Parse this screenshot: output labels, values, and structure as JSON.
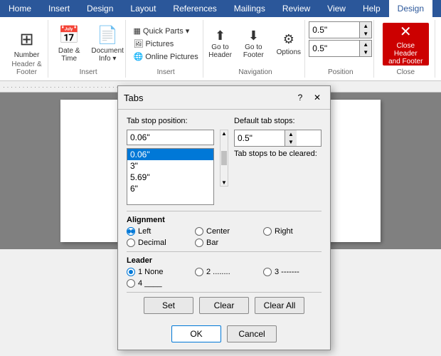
{
  "ribbon": {
    "tabs": [
      "Home",
      "Insert",
      "Design",
      "Layout",
      "References",
      "Mailings",
      "Review",
      "View",
      "Help",
      "Design"
    ],
    "active_tab": "Design",
    "groups": {
      "number": {
        "label": "Header & Footer",
        "btn": "Number"
      },
      "datetime": {
        "label": "Insert",
        "btn1": "Date &\nTime",
        "btn2": "Document\nInfo"
      },
      "insert": {
        "label": "Insert",
        "items": [
          "Quick Parts",
          "Pictures",
          "Online Pictures"
        ]
      },
      "navigation": {
        "label": "Navigation",
        "go_to_header": "Go to\nHeader",
        "go_to_footer": "Go to\nFooter",
        "options": "Options"
      },
      "position": {
        "label": "Position",
        "val1": "0.5\"",
        "val2": "0.5\""
      },
      "close": {
        "label": "Close",
        "btn": "Close Header\nand Footer"
      }
    }
  },
  "dialog": {
    "title": "Tabs",
    "tab_stop_position_label": "Tab stop position:",
    "tab_stop_position_value": "0.06\"",
    "default_tab_stops_label": "Default tab stops:",
    "default_tab_stops_value": "0.5\"",
    "tab_stops_to_clear_label": "Tab stops to be cleared:",
    "list_items": [
      "0.06\"",
      "3\"",
      "5.69\"",
      "6\""
    ],
    "selected_item": "0.06\"",
    "alignment": {
      "label": "Alignment",
      "options": [
        {
          "id": "left",
          "label": "Left",
          "checked": true
        },
        {
          "id": "center",
          "label": "Center",
          "checked": false
        },
        {
          "id": "right",
          "label": "Right",
          "checked": false
        },
        {
          "id": "decimal",
          "label": "Decimal",
          "checked": false
        },
        {
          "id": "bar",
          "label": "Bar",
          "checked": false
        }
      ]
    },
    "leader": {
      "label": "Leader",
      "options": [
        {
          "id": "1",
          "label": "1 None",
          "checked": true
        },
        {
          "id": "2",
          "label": "2 ........",
          "checked": false
        },
        {
          "id": "3",
          "label": "3 -------",
          "checked": false
        },
        {
          "id": "4",
          "label": "4 ____",
          "checked": false
        }
      ]
    },
    "buttons": {
      "set": "Set",
      "clear": "Clear",
      "clear_all": "Clear All",
      "ok": "OK",
      "cancel": "Cancel"
    }
  }
}
